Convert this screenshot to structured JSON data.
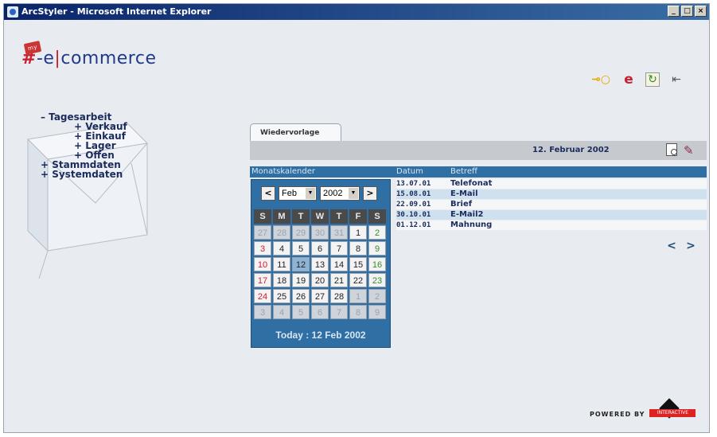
{
  "window": {
    "title": "ArcStyler - Microsoft Internet Explorer"
  },
  "logo": {
    "badge": "my",
    "hash": "#",
    "e": "-e",
    "bar": "|",
    "commerce": "commerce"
  },
  "nav": [
    {
      "label": "– Tagesarbeit",
      "level": 0
    },
    {
      "label": "+ Verkauf",
      "level": 1
    },
    {
      "label": "+ Einkauf",
      "level": 1
    },
    {
      "label": "+ Lager",
      "level": 1
    },
    {
      "label": "+ Offen",
      "level": 1
    },
    {
      "label": "+ Stammdaten",
      "level": 0
    },
    {
      "label": "+ Systemdaten",
      "level": 0
    }
  ],
  "tab": {
    "label": "Wiedervorlage"
  },
  "header": {
    "date": "12. Februar 2002"
  },
  "columns": {
    "calendar": "Monatskalender",
    "datum": "Datum",
    "betreff": "Betreff"
  },
  "calendar": {
    "month": "Feb",
    "year": "2002",
    "weekdays": [
      "S",
      "M",
      "T",
      "W",
      "T",
      "F",
      "S"
    ],
    "weeks": [
      [
        "27",
        "28",
        "29",
        "30",
        "31",
        "1",
        "2"
      ],
      [
        "3",
        "4",
        "5",
        "6",
        "7",
        "8",
        "9"
      ],
      [
        "10",
        "11",
        "12",
        "13",
        "14",
        "15",
        "16"
      ],
      [
        "17",
        "18",
        "19",
        "20",
        "21",
        "22",
        "23"
      ],
      [
        "24",
        "25",
        "26",
        "27",
        "28",
        "1",
        "2"
      ],
      [
        "3",
        "4",
        "5",
        "6",
        "7",
        "8",
        "9"
      ]
    ],
    "today_label": "Today : 12 Feb 2002"
  },
  "entries": [
    {
      "datum": "13.07.01",
      "betreff": "Telefonat"
    },
    {
      "datum": "15.08.01",
      "betreff": "E-Mail"
    },
    {
      "datum": "22.09.01",
      "betreff": "Brief"
    },
    {
      "datum": "30.10.01",
      "betreff": "E-Mail2"
    },
    {
      "datum": "01.12.01",
      "betreff": "Mahnung"
    }
  ],
  "pager": {
    "prev": "<",
    "next": ">"
  },
  "footer": {
    "powered": "POWERED BY",
    "brand": "INTERACTIVE"
  }
}
